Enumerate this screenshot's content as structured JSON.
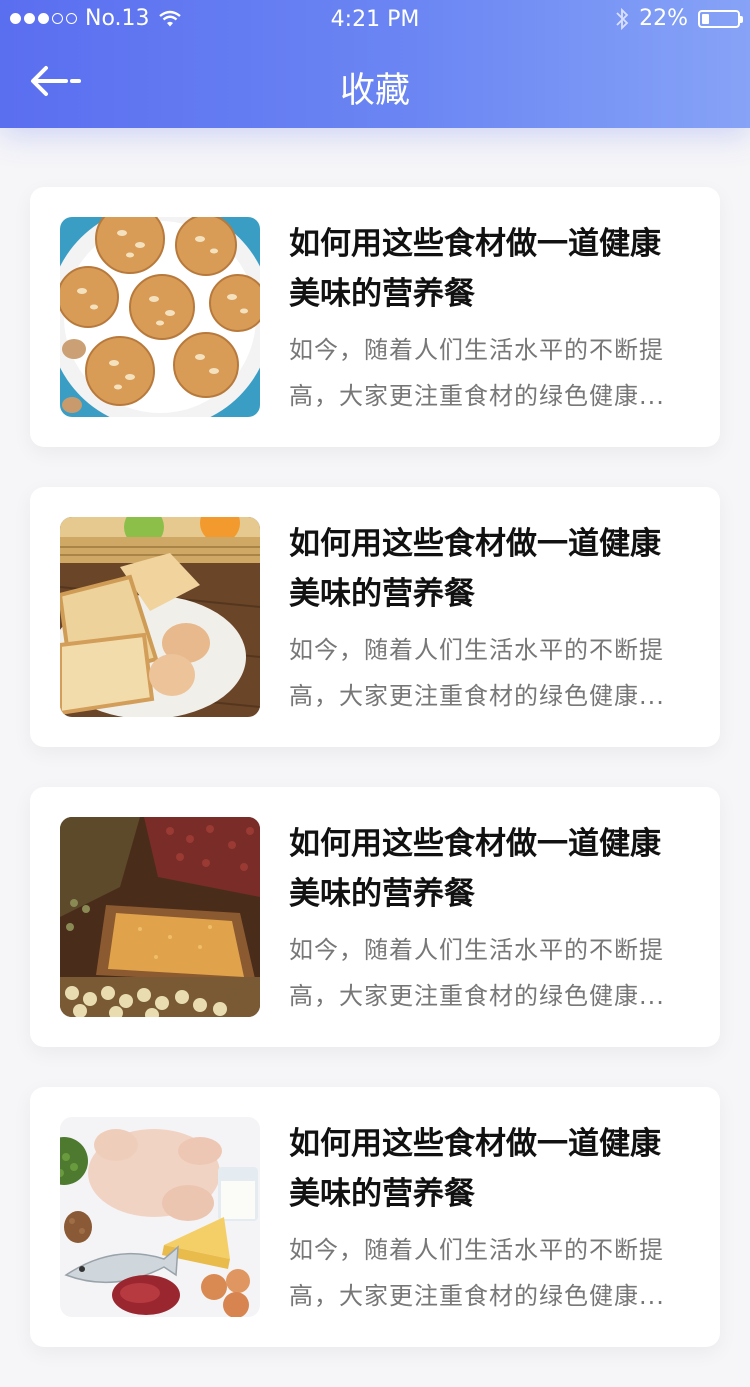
{
  "status_bar": {
    "carrier": "No.13",
    "time": "4:21 PM",
    "battery": "22%",
    "battery_level": 0.22,
    "signal_bars": 3,
    "icons": [
      "signal-dots-icon",
      "wifi-icon",
      "bluetooth-icon",
      "battery-icon"
    ]
  },
  "nav": {
    "title": "收藏",
    "back_icon": "back-arrow-icon"
  },
  "favorites": [
    {
      "title": "如何用这些食材做一道健康美味的营养餐",
      "desc_line1": "如今，随着人们生活水平的不断提",
      "desc_line2": "高，大家更注重食材的绿色健康...",
      "image": "oat-cookies-photo"
    },
    {
      "title": "如何用这些食材做一道健康美味的营养餐",
      "desc_line1": "如今，随着人们生活水平的不断提",
      "desc_line2": "高，大家更注重食材的绿色健康...",
      "image": "bread-eggs-photo"
    },
    {
      "title": "如何用这些食材做一道健康美味的营养餐",
      "desc_line1": "如今，随着人们生活水平的不断提",
      "desc_line2": "高，大家更注重食材的绿色健康...",
      "image": "grains-beans-photo"
    },
    {
      "title": "如何用这些食材做一道健康美味的营养餐",
      "desc_line1": "如今，随着人们生活水平的不断提",
      "desc_line2": "高，大家更注重食材的绿色健康...",
      "image": "chicken-fish-meat-photo"
    }
  ],
  "colors": {
    "header_gradient_start": "#5a6ef0",
    "header_gradient_end": "#86a3f7",
    "title_text": "#111111",
    "desc_text": "#777777",
    "page_bg": "#f6f6f8"
  }
}
